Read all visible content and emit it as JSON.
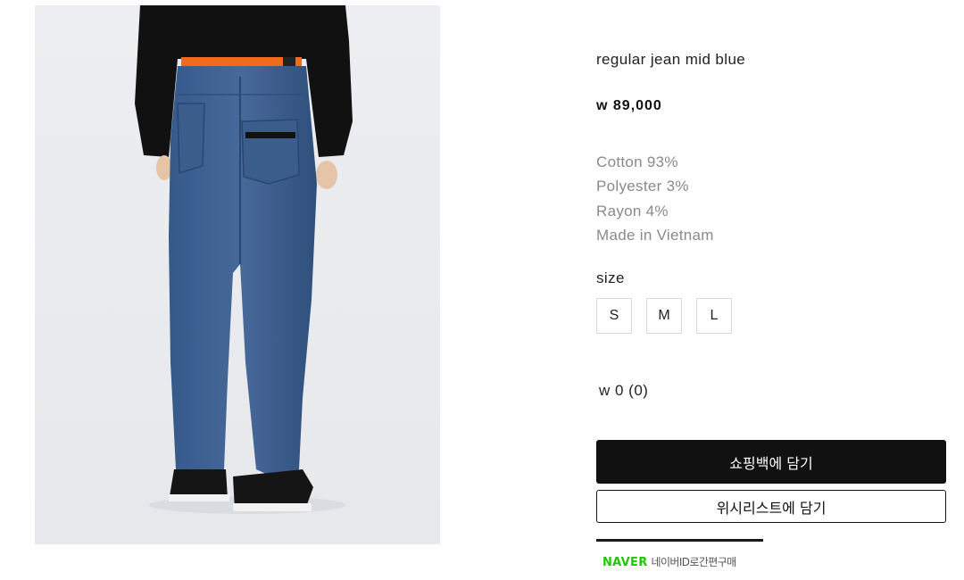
{
  "product": {
    "image_alt": "model wearing regular jean mid blue, rear view",
    "title": "regular jean mid blue",
    "price": "w 89,000",
    "materials": [
      "Cotton 93%",
      "Polyester 3%",
      "Rayon 4%",
      "Made in Vietnam"
    ]
  },
  "size": {
    "label": "size",
    "options": [
      "S",
      "M",
      "L"
    ]
  },
  "total": "w 0 (0)",
  "actions": {
    "add_to_cart": "쇼핑백에 담기",
    "add_to_wishlist": "위시리스트에 담기"
  },
  "naver": {
    "brand": "NAVER",
    "text": "네이버ID로간편구매"
  },
  "colors": {
    "denim": "#3e5f8f",
    "orange_belt": "#f26a1b",
    "naver_green": "#1ec800",
    "muted_text": "#8a8a8a"
  }
}
